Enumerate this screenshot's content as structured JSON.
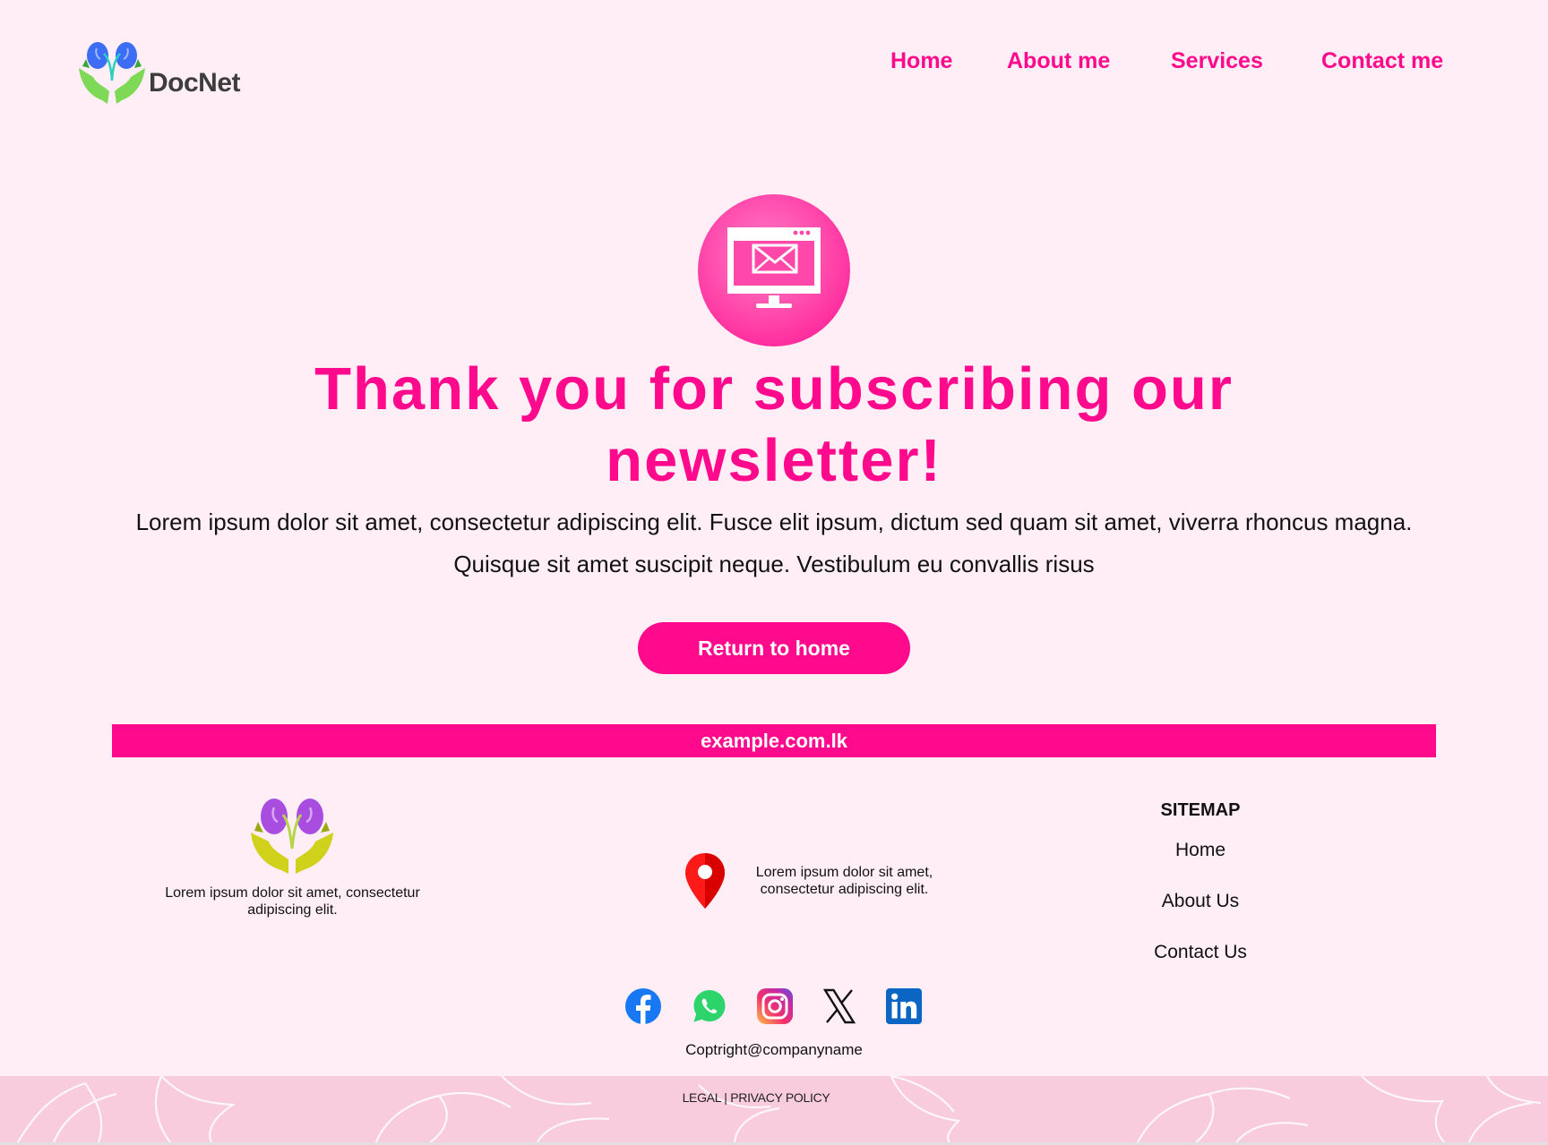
{
  "brand": {
    "name": "DocNet"
  },
  "nav": [
    {
      "label": "Home"
    },
    {
      "label": "About me"
    },
    {
      "label": "Services"
    },
    {
      "label": "Contact me"
    }
  ],
  "hero": {
    "icon": "newsletter-monitor-mail-icon",
    "title": "Thank you for subscribing our newsletter!",
    "body": "Lorem ipsum dolor sit amet, consectetur adipiscing elit. Fusce elit ipsum, dictum sed quam sit amet, viverra rhoncus magna. Quisque sit amet suscipit neque. Vestibulum eu convallis risus",
    "button_label": "Return to home"
  },
  "domain_bar": {
    "text": "example.com.lk"
  },
  "footer": {
    "description": "Lorem ipsum dolor sit amet, consectetur adipiscing elit.",
    "address": "Lorem ipsum dolor sit amet, consectetur adipiscing elit.",
    "sitemap": {
      "title": "SITEMAP",
      "links": [
        {
          "label": "Home"
        },
        {
          "label": "About Us"
        },
        {
          "label": "Contact Us"
        }
      ]
    },
    "social": [
      "facebook-icon",
      "whatsapp-icon",
      "instagram-icon",
      "x-icon",
      "linkedin-icon"
    ],
    "copyright": "Coptright@companyname",
    "legal": {
      "legal_label": "LEGAL",
      "separator": "|",
      "privacy_label": "PRIVACY POLICY"
    }
  },
  "colors": {
    "accent": "#ff0a8c",
    "background": "#ffeef5",
    "bottom_band": "#f8cbdd"
  }
}
